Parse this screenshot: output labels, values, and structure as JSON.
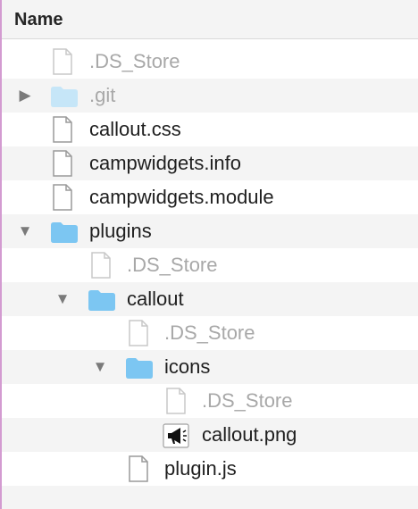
{
  "header": {
    "column_label": "Name"
  },
  "rows": [
    {
      "name": ".DS_Store",
      "kind": "file",
      "dim": true
    },
    {
      "name": ".git",
      "kind": "folder",
      "dim": true,
      "disclosure": "collapsed",
      "disclosure_glyph": "▶"
    },
    {
      "name": "callout.css",
      "kind": "file"
    },
    {
      "name": "campwidgets.info",
      "kind": "file"
    },
    {
      "name": "campwidgets.module",
      "kind": "file"
    },
    {
      "name": "plugins",
      "kind": "folder",
      "disclosure": "expanded",
      "disclosure_glyph": "▼"
    },
    {
      "name": ".DS_Store",
      "kind": "file",
      "dim": true
    },
    {
      "name": "callout",
      "kind": "folder",
      "disclosure": "expanded",
      "disclosure_glyph": "▼"
    },
    {
      "name": ".DS_Store",
      "kind": "file",
      "dim": true
    },
    {
      "name": "icons",
      "kind": "folder",
      "disclosure": "expanded",
      "disclosure_glyph": "▼"
    },
    {
      "name": ".DS_Store",
      "kind": "file",
      "dim": true
    },
    {
      "name": "callout.png",
      "kind": "image",
      "icon": "megaphone-icon"
    },
    {
      "name": "plugin.js",
      "kind": "file"
    }
  ],
  "colors": {
    "folder": "#7cc6f2",
    "folder_dim": "#c6e6f8",
    "alt_row": "#f4f4f4",
    "dim_text": "#a8a8a8"
  }
}
